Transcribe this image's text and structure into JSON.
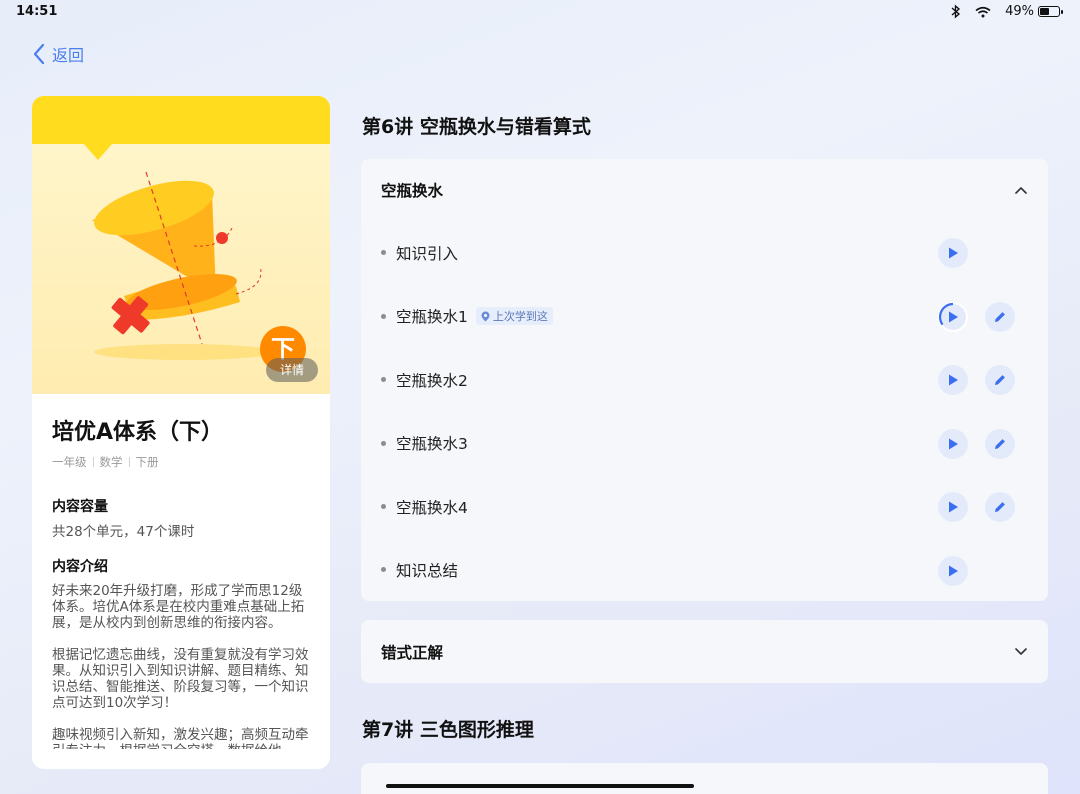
{
  "status_bar": {
    "time": "14:51",
    "battery": "49%",
    "battery_level": 0.49
  },
  "nav": {
    "back_label": "返回",
    "back_icon": "chevron-left-icon"
  },
  "course": {
    "title": "培优A体系（下）",
    "meta": [
      "一年级",
      "数学",
      "下册"
    ],
    "grade_badge": "下",
    "detail_label": "详情",
    "capacity_title": "内容容量",
    "capacity_text": "共28个单元，47个课时",
    "intro_title": "内容介绍",
    "intro_paragraphs": [
      "好未来20年升级打磨，形成了学而思12级体系。培优A体系是在校内重难点基础上拓展，是从校内到创新思维的衔接内容。",
      "根据记忆遗忘曲线，没有重复就没有学习效果。从知识引入到知识讲解、题目精练、知识总结、智能推送、阶段复习等，一个知识点可达到10次学习！",
      "趣味视频引入新知，激发兴趣；高频互动牵引专注力，根据学习全究塔，数据给他"
    ]
  },
  "lectures": [
    {
      "title": "第6讲  空瓶换水与错看算式",
      "sections": [
        {
          "title": "空瓶换水",
          "expanded": true,
          "items": [
            {
              "label": "知识引入",
              "has_edit": false,
              "last_studied": false
            },
            {
              "label": "空瓶换水1",
              "has_edit": true,
              "last_studied": true,
              "tag": "上次学到这"
            },
            {
              "label": "空瓶换水2",
              "has_edit": true,
              "last_studied": false
            },
            {
              "label": "空瓶换水3",
              "has_edit": true,
              "last_studied": false
            },
            {
              "label": "空瓶换水4",
              "has_edit": true,
              "last_studied": false
            },
            {
              "label": "知识总结",
              "has_edit": false,
              "last_studied": false
            }
          ]
        },
        {
          "title": "错式正解",
          "expanded": false,
          "items": []
        }
      ]
    },
    {
      "title": "第7讲  三色图形推理",
      "sections": []
    }
  ],
  "colors": {
    "accent": "#4a7df0",
    "cover_yellow": "#ffdc1e",
    "badge_orange": "#ff8a00",
    "panel_bg": "#f6f7fa"
  }
}
